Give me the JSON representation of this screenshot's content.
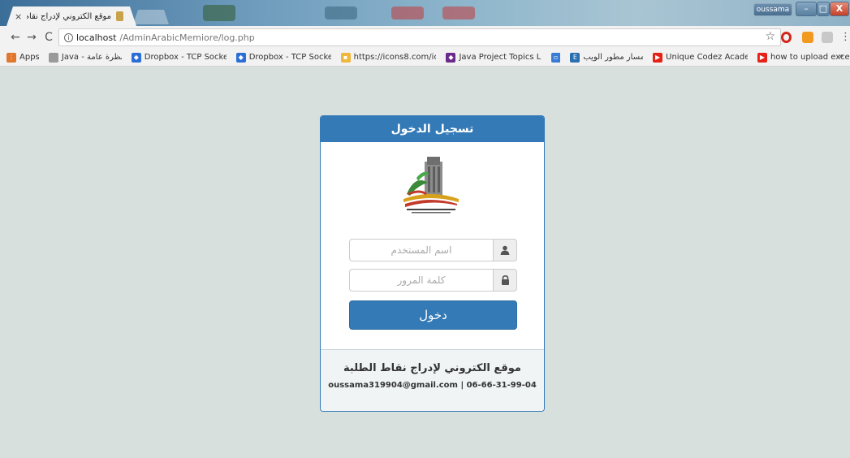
{
  "browser": {
    "tab": {
      "title": "موقع الكتروني لإدراج نقاط الطلبة",
      "close": "×"
    },
    "profile": "oussama",
    "window_buttons": {
      "minimize": "–",
      "maximize": "□",
      "close": "X"
    },
    "address": {
      "host": "localhost",
      "path": "/AdminArabicMemiore/log.php"
    },
    "bookmarks": [
      {
        "label": "Apps",
        "icon": "apps-grid-icon",
        "color": "#e0772c"
      },
      {
        "label": "Java - نظرة عامة",
        "icon": "page-icon",
        "color": "#9a9a9a"
      },
      {
        "label": "Dropbox - TCP Socke",
        "icon": "dropbox-icon",
        "color": "#2b6fd6"
      },
      {
        "label": "Dropbox - TCP Socke",
        "icon": "dropbox-icon",
        "color": "#2b6fd6"
      },
      {
        "label": "https://icons8.com/ic",
        "icon": "icons8-icon",
        "color": "#f0b83a"
      },
      {
        "label": "Java Project Topics Li",
        "icon": "diamond-icon",
        "color": "#6a2a8c"
      },
      {
        "label": "",
        "icon": "window-icon",
        "color": "#3a7bd5"
      },
      {
        "label": "مسار مطور الويب",
        "icon": "e-icon",
        "color": "#2a6fb0"
      },
      {
        "label": "Unique Codez Acade",
        "icon": "youtube-icon",
        "color": "#e62117"
      },
      {
        "label": "how to upload excel",
        "icon": "youtube-icon",
        "color": "#e62117"
      }
    ],
    "bookmarks_more": "»"
  },
  "login": {
    "header": "تسجيل الدخول",
    "username_placeholder": "اسم المستخدم",
    "password_placeholder": "كلمة المرور",
    "submit": "دخول"
  },
  "footer": {
    "title": "موقع الكتروني لإدراج نقاط الطلبة",
    "contact": "oussama319904@gmail.com | 06-66-31-99-04"
  },
  "colors": {
    "primary": "#337ab7",
    "page_bg": "#d8e0dd"
  }
}
